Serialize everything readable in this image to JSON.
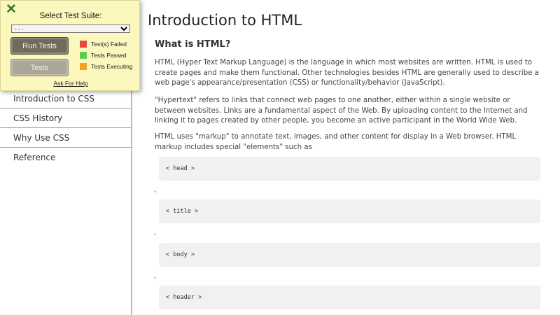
{
  "sidebar": {
    "items": [
      {
        "label": "Introduction to CSS"
      },
      {
        "label": "CSS History"
      },
      {
        "label": "Why Use CSS"
      },
      {
        "label": "Reference"
      }
    ]
  },
  "main": {
    "title": "Introduction to HTML",
    "heading": "What is HTML?",
    "paragraphs": [
      "HTML (Hyper Text Markup Language) is the language in which most websites are written. HTML is used to create pages and make them functional. Other technologies besides HTML are generally used to describe a web page's appearance/presentation (CSS) or functionality/behavior (JavaScript).",
      "\"Hypertext\" refers to links that connect web pages to one another, either within a single website or between websites. Links are a fundamental aspect of the Web. By uploading content to the Internet and linking it to pages created by other people, you become an active participant in the World Wide Web.",
      "HTML uses \"markup\" to annotate text, images, and other content for display in a Web browser. HTML markup includes special \"elements\" such as"
    ],
    "code_items": [
      "< head >",
      "< title >",
      "< body >",
      "< header >"
    ],
    "separator": ","
  },
  "test_panel": {
    "close_glyph": "✕",
    "suite_label": "Select Test Suite:",
    "suite_selected": "- - -",
    "run_button": "Run Tests",
    "tests_button": "Tests",
    "legend": [
      {
        "label": "Test(s) Failed",
        "color": "#e8493a"
      },
      {
        "label": "Tests Passed",
        "color": "#5ecb4c"
      },
      {
        "label": "Tests Executing",
        "color": "#f5a31c"
      }
    ],
    "help_link": "Ask For Help"
  }
}
